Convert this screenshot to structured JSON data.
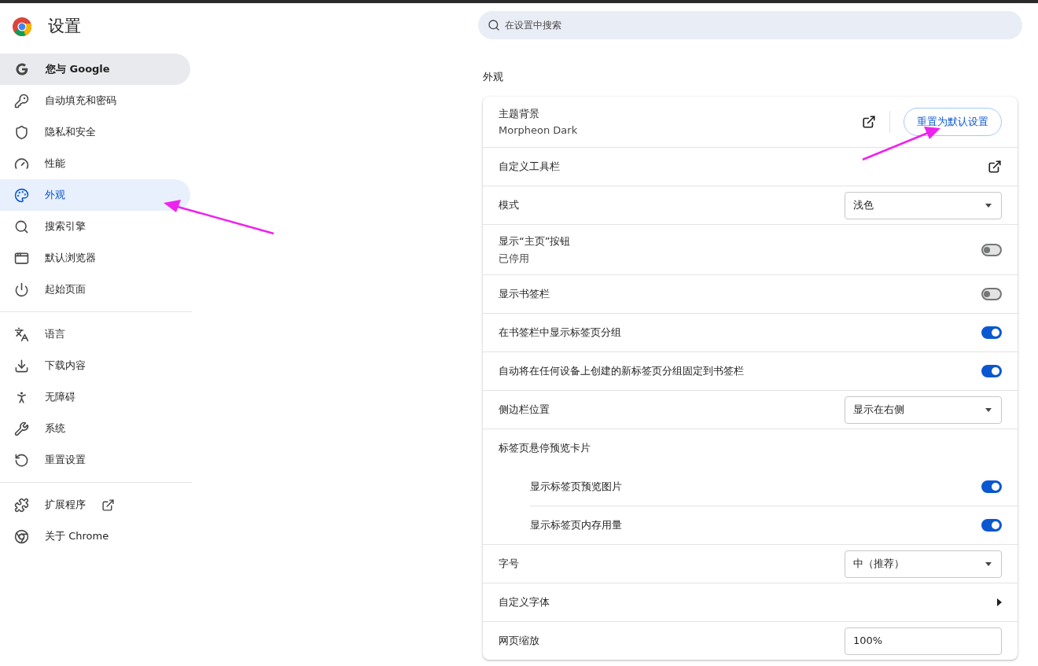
{
  "header": {
    "title": "设置"
  },
  "search": {
    "placeholder": "在设置中搜索"
  },
  "sidebar": {
    "groups": [
      [
        {
          "label": "您与 Google",
          "selected": false,
          "hovered": true
        },
        {
          "label": "自动填充和密码",
          "selected": false,
          "hovered": false
        },
        {
          "label": "隐私和安全",
          "selected": false,
          "hovered": false
        },
        {
          "label": "性能",
          "selected": false,
          "hovered": false
        },
        {
          "label": "外观",
          "selected": true,
          "hovered": false
        },
        {
          "label": "搜索引擎",
          "selected": false,
          "hovered": false
        },
        {
          "label": "默认浏览器",
          "selected": false,
          "hovered": false
        },
        {
          "label": "起始页面",
          "selected": false,
          "hovered": false
        }
      ],
      [
        {
          "label": "语言",
          "selected": false,
          "hovered": false
        },
        {
          "label": "下载内容",
          "selected": false,
          "hovered": false
        },
        {
          "label": "无障碍",
          "selected": false,
          "hovered": false
        },
        {
          "label": "系统",
          "selected": false,
          "hovered": false
        },
        {
          "label": "重置设置",
          "selected": false,
          "hovered": false
        }
      ],
      [
        {
          "label": "扩展程序",
          "selected": false,
          "hovered": false,
          "external": true
        },
        {
          "label": "关于 Chrome",
          "selected": false,
          "hovered": false
        }
      ]
    ]
  },
  "section": {
    "title": "外观",
    "rows": [
      {
        "kind": "theme",
        "label": "主题背景",
        "sublabel": "Morpheon Dark",
        "button": "重置为默认设置"
      },
      {
        "kind": "link",
        "label": "自定义工具栏"
      },
      {
        "kind": "select",
        "label": "模式",
        "value": "浅色"
      },
      {
        "kind": "toggle",
        "label": "显示“主页”按钮",
        "sublabel": "已停用",
        "on": false
      },
      {
        "kind": "toggle",
        "label": "显示书签栏",
        "on": false
      },
      {
        "kind": "toggle",
        "label": "在书签栏中显示标签页分组",
        "on": true
      },
      {
        "kind": "toggle",
        "label": "自动将在任何设备上创建的新标签页分组固定到书签栏",
        "on": true
      },
      {
        "kind": "select",
        "label": "侧边栏位置",
        "value": "显示在右侧"
      },
      {
        "kind": "heading",
        "label": "标签页悬停预览卡片"
      },
      {
        "kind": "subtoggle",
        "label": "显示标签页预览图片",
        "on": true
      },
      {
        "kind": "subtoggle",
        "label": "显示标签页内存用量",
        "on": true
      },
      {
        "kind": "select",
        "label": "字号",
        "value": "中（推荐）"
      },
      {
        "kind": "arrow",
        "label": "自定义字体"
      },
      {
        "kind": "field",
        "label": "网页缩放",
        "value": "100%"
      }
    ]
  }
}
